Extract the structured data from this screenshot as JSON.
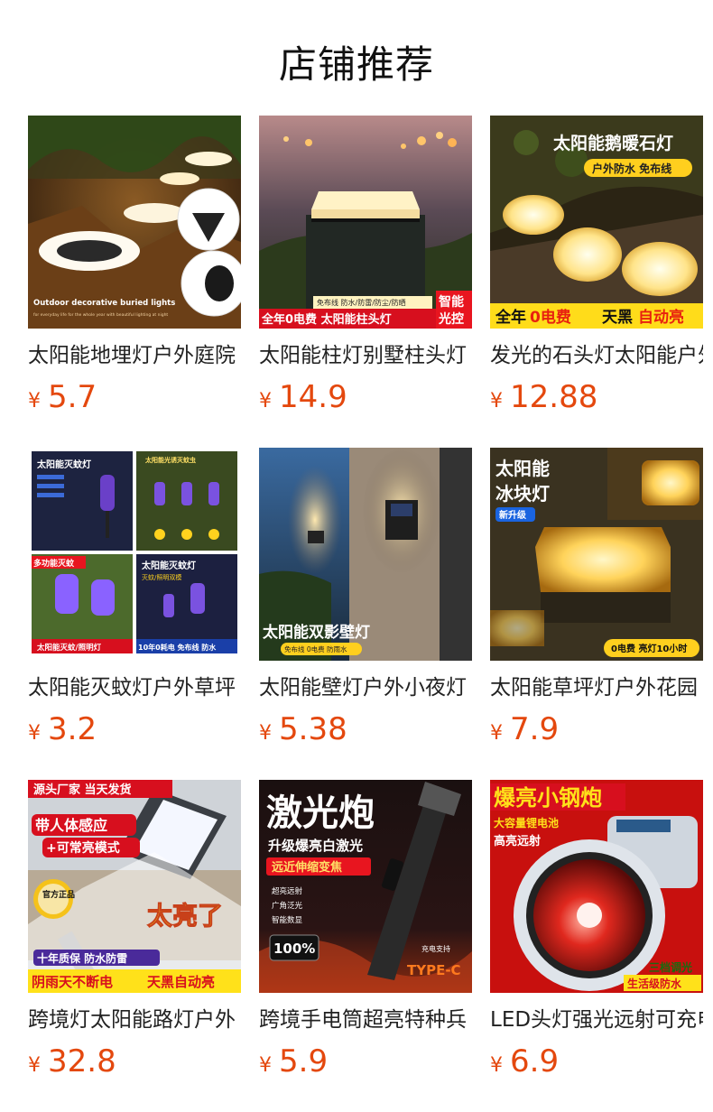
{
  "page_title": "店铺推荐",
  "currency_symbol": "¥",
  "products": [
    {
      "name": "太阳能地埋灯户外庭院",
      "price": "5.7",
      "image_text": {
        "caption": "Outdoor decorative buried lights",
        "subcaption": "for everyday life for the whole year with beautiful lighting at night"
      }
    },
    {
      "name": "太阳能柱灯别墅柱头灯",
      "price": "14.9",
      "image_text": {
        "tags": "免布线 防水/防雷/防尘/防晒",
        "banner": "全年0电费 太阳能柱头灯",
        "badge_line1": "智能",
        "badge_line2": "光控"
      }
    },
    {
      "name": "发光的石头灯太阳能户外",
      "price": "12.88",
      "image_text": {
        "headline": "太阳能鹅暖石灯",
        "subline": "户外防水 免布线",
        "banner_a": "全年",
        "banner_b": "0电费",
        "banner_c": "天黑",
        "banner_d": "自动亮"
      }
    },
    {
      "name": "太阳能灭蚊灯户外草坪",
      "price": "3.2",
      "image_text": {
        "q1": "太阳能灭蚊灯",
        "q2": "太阳能光诱灭蚊虫",
        "q3": "多功能灭蚊",
        "q4": "太阳能灭蚊灯",
        "q4_sub": "灭蚊/照明双模",
        "foot_left": "太阳能灭蚊/照明灯",
        "foot_right": "10年0耗电 免布线 防水"
      }
    },
    {
      "name": "太阳能壁灯户外小夜灯",
      "price": "5.38",
      "image_text": {
        "headline": "太阳能双影壁灯",
        "tag": "免布线 0电费 防雨水"
      }
    },
    {
      "name": "太阳能草坪灯户外花园",
      "price": "7.9",
      "image_text": {
        "headline1": "太阳能",
        "headline2": "冰块灯",
        "badge": "新升级",
        "footer": "0电费 亮灯10小时"
      }
    },
    {
      "name": "跨境灯太阳能路灯户外",
      "price": "32.8",
      "image_text": {
        "top": "源头厂家 当天发货",
        "feature1": "带人体感应",
        "feature2": "+可常亮模式",
        "seal": "官方正品",
        "big": "太亮了",
        "quality": "十年质保 防水防雷",
        "bottom_left": "阴雨天不断电",
        "bottom_right": "天黑自动亮"
      }
    },
    {
      "name": "跨境手电筒超亮特种兵",
      "price": "5.9",
      "image_text": {
        "headline": "激光炮",
        "sub": "升级爆亮白激光",
        "tag": "远近伸缩变焦",
        "bullet1": "超亮远射",
        "bullet2": "广角泛光",
        "bullet3": "智能数显",
        "display": "100%",
        "charge": "充电支持",
        "type": "TYPE-C"
      }
    },
    {
      "name": "LED头灯强光远射可充电",
      "price": "6.9",
      "image_text": {
        "headline": "爆亮小钢炮",
        "sub1": "大容量锂电池",
        "sub2": "高亮远射",
        "tag1": "三档调光",
        "tag2": "生活级防水"
      }
    }
  ],
  "colors": {
    "price": "#e4480e",
    "title": "#111111",
    "product_name": "#222222"
  }
}
